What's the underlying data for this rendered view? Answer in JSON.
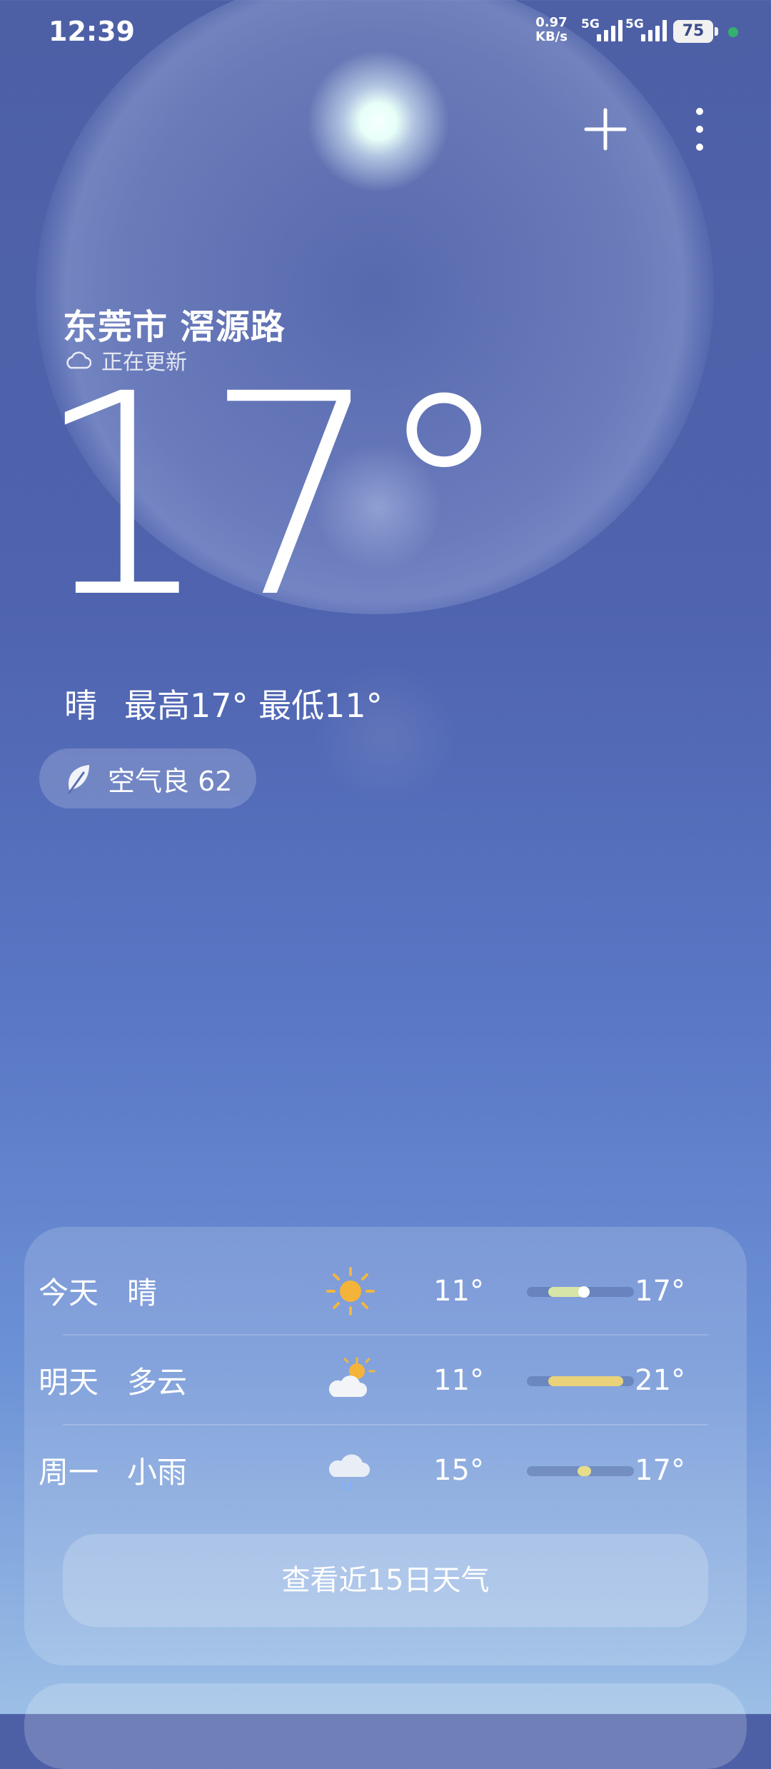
{
  "status_bar": {
    "time": "12:39",
    "net_speed": "0.97",
    "net_speed_unit": "KB/s",
    "signal_1": "5G",
    "signal_2": "5G",
    "battery": "75"
  },
  "header": {
    "add_icon": "plus-icon",
    "menu_icon": "more-vertical-icon"
  },
  "current": {
    "location": "东莞市 滘源路",
    "update_status": "正在更新",
    "temperature": "17°",
    "condition": "晴",
    "high_low": "最高17° 最低11°",
    "air_quality": "空气良 62"
  },
  "forecast": {
    "rows": [
      {
        "day": "今天",
        "condition": "晴",
        "icon": "sun-icon",
        "low": "11°",
        "high": "17°",
        "range_start": 0.2,
        "range_end": 0.55,
        "current": 0.53,
        "color": "#d7e6a8"
      },
      {
        "day": "明天",
        "condition": "多云",
        "icon": "partly-cloudy-icon",
        "low": "11°",
        "high": "21°",
        "range_start": 0.2,
        "range_end": 0.9,
        "color": "#e9d27a"
      },
      {
        "day": "周一",
        "condition": "小雨",
        "icon": "light-rain-icon",
        "low": "15°",
        "high": "17°",
        "range_start": 0.47,
        "range_end": 0.6,
        "color": "#e6dd8a"
      }
    ],
    "view_more": "查看近15日天气"
  }
}
